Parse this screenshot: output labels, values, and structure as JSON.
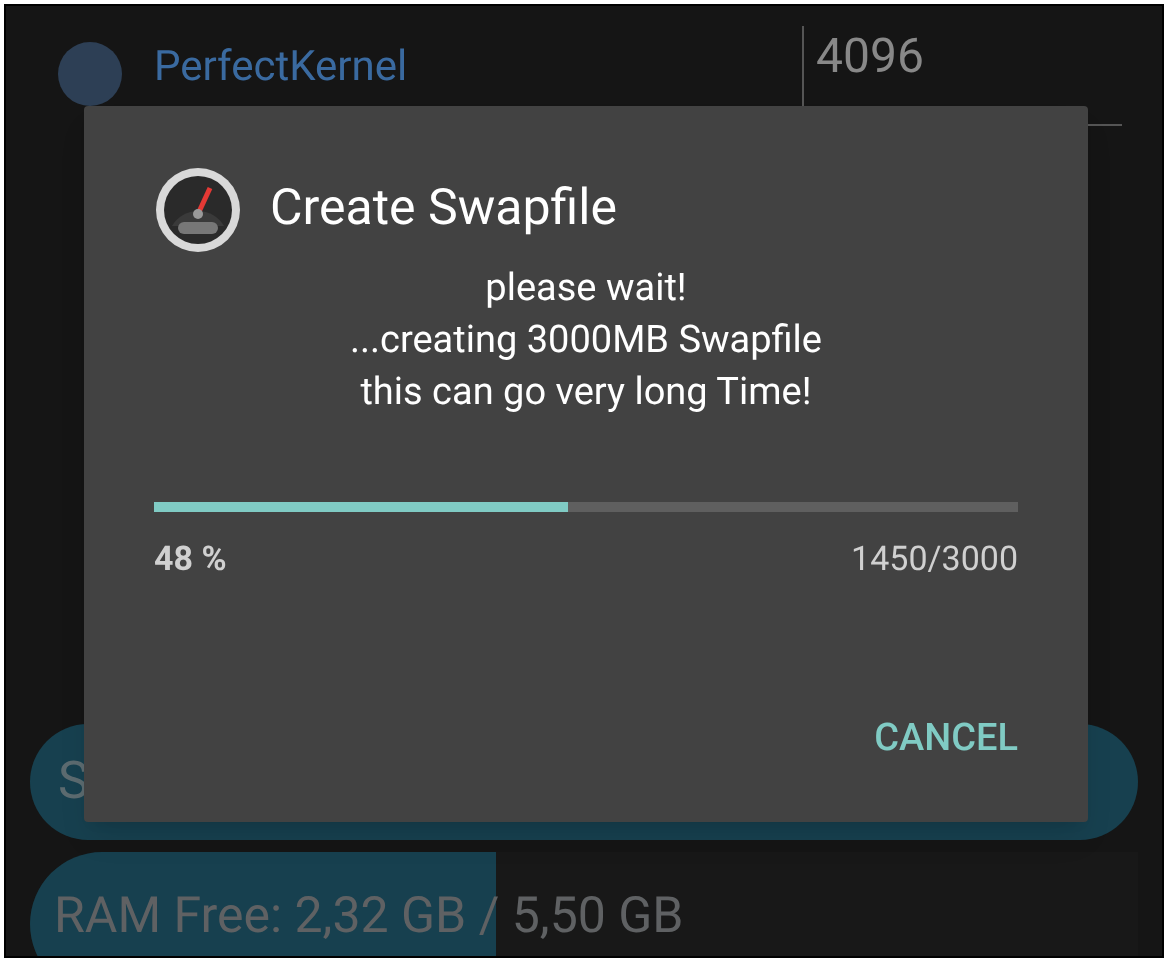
{
  "background": {
    "radio_selected": false,
    "radio_label": "PerfectKernel",
    "value_field": "4096",
    "swap_button": "S",
    "ram_bar": {
      "label": "RAM Free: 2,32 GB / 5,50 GB",
      "level": 0.42
    }
  },
  "dialog": {
    "title": "Create Swapfile",
    "message": [
      "please wait!",
      "...creating 3000MB Swapfile",
      "this can go very long Time!"
    ],
    "progress": {
      "level": 0.48,
      "percent": "48 %",
      "count": "1450/3000"
    },
    "buttons": [
      "CANCEL"
    ]
  }
}
